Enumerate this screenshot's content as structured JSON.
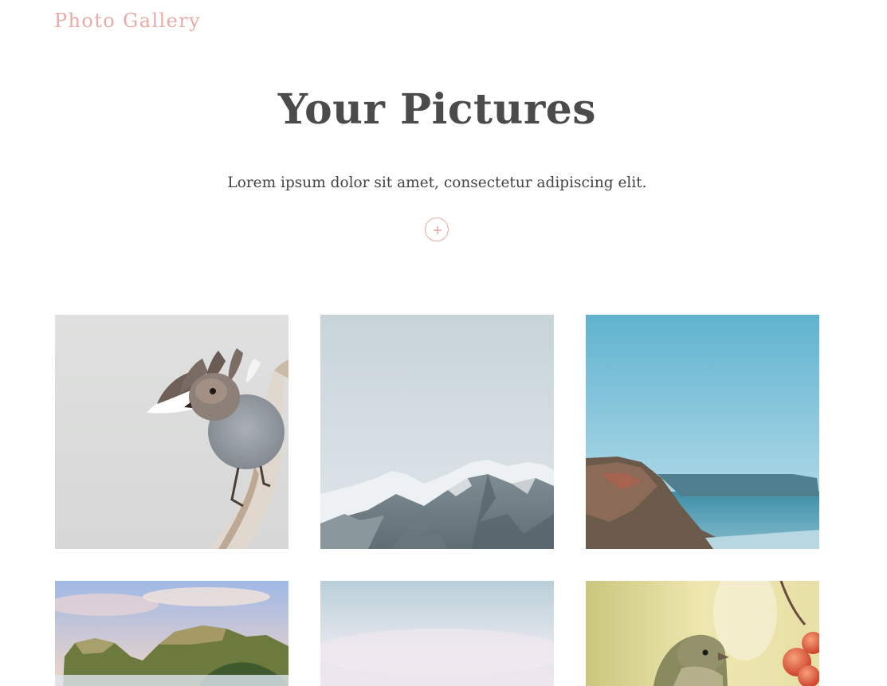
{
  "header": {
    "brand": "Photo Gallery"
  },
  "hero": {
    "title": "Your Pictures",
    "subtitle": "Lorem ipsum dolor sit amet, consectetur adipiscing elit."
  },
  "actions": {
    "add_icon": "plus-circle-icon"
  },
  "gallery": {
    "photos": [
      {
        "subject": "bird-on-branch"
      },
      {
        "subject": "snowy-mountains"
      },
      {
        "subject": "sea-cliffs"
      },
      {
        "subject": "green-hills"
      },
      {
        "subject": "misty-sky"
      },
      {
        "subject": "finch-with-berries"
      }
    ]
  },
  "colors": {
    "accent": "#ebaaa6",
    "heading": "#4b4b4b",
    "body_text": "#444444",
    "background": "#ffffff"
  }
}
